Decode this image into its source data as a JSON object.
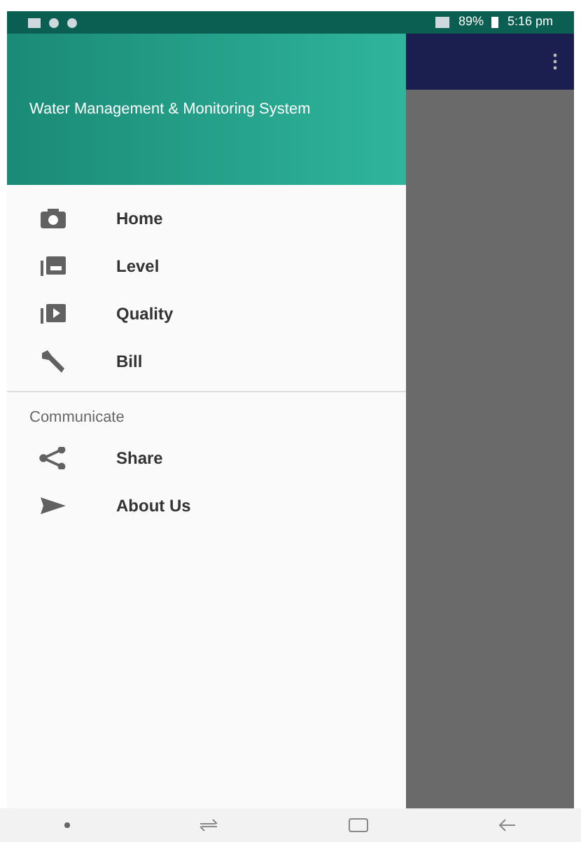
{
  "status_bar": {
    "battery": "89%",
    "time": "5:16 pm"
  },
  "drawer": {
    "title": "Water Management & Monitoring System",
    "items": [
      {
        "label": "Home"
      },
      {
        "label": "Level"
      },
      {
        "label": "Quality"
      },
      {
        "label": "Bill"
      }
    ],
    "section": {
      "title": "Communicate",
      "items": [
        {
          "label": "Share"
        },
        {
          "label": "About Us"
        }
      ]
    }
  }
}
